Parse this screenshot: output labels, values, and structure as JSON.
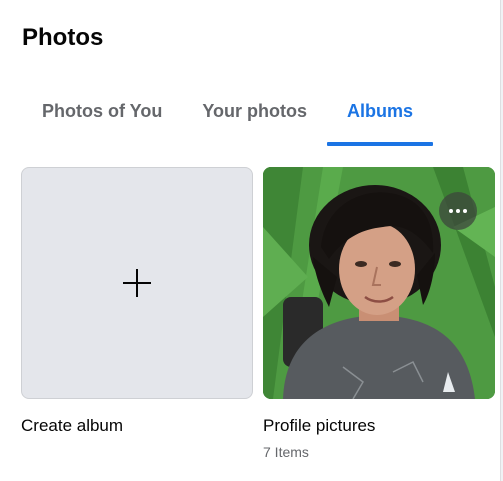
{
  "header": {
    "title": "Photos"
  },
  "tabs": [
    {
      "label": "Photos of You",
      "active": false
    },
    {
      "label": "Your photos",
      "active": false
    },
    {
      "label": "Albums",
      "active": true
    }
  ],
  "albums": {
    "create": {
      "label": "Create album",
      "icon": "plus-icon"
    },
    "items": [
      {
        "title": "Profile pictures",
        "count": "7 Items",
        "menu_icon": "more-horizontal-icon"
      }
    ]
  },
  "colors": {
    "accent": "#1b74e4",
    "text_primary": "#050505",
    "text_secondary": "#65676b"
  }
}
